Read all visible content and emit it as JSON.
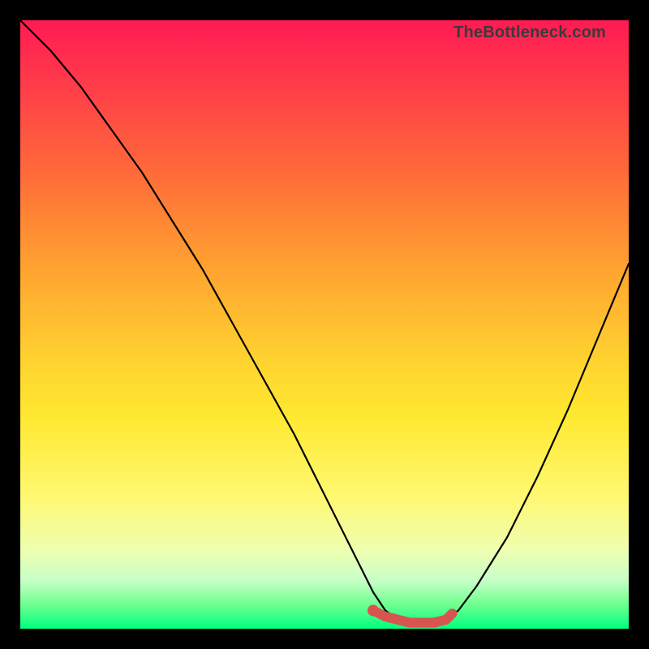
{
  "attribution": "TheBottleneck.com",
  "chart_data": {
    "type": "line",
    "title": "",
    "xlabel": "",
    "ylabel": "",
    "xlim": [
      0,
      100
    ],
    "ylim": [
      0,
      100
    ],
    "series": [
      {
        "name": "bottleneck-curve",
        "color": "#000000",
        "x": [
          0,
          5,
          10,
          15,
          20,
          25,
          30,
          35,
          40,
          45,
          50,
          55,
          58,
          60,
          62,
          64,
          66,
          68,
          70,
          72,
          75,
          80,
          85,
          90,
          95,
          100
        ],
        "values": [
          100,
          95,
          89,
          82,
          75,
          67,
          59,
          50,
          41,
          32,
          22,
          12,
          6,
          3,
          1.5,
          1,
          1,
          1,
          1.5,
          3,
          7,
          15,
          25,
          36,
          48,
          60
        ]
      },
      {
        "name": "optimal-highlight",
        "color": "#d9534f",
        "x": [
          58,
          60,
          62,
          64,
          66,
          68,
          70,
          71
        ],
        "values": [
          3,
          2,
          1.5,
          1,
          1,
          1,
          1.5,
          2.5
        ]
      }
    ],
    "markers": [
      {
        "name": "optimal-point",
        "x": 58,
        "y": 3,
        "color": "#d9534f"
      }
    ]
  }
}
